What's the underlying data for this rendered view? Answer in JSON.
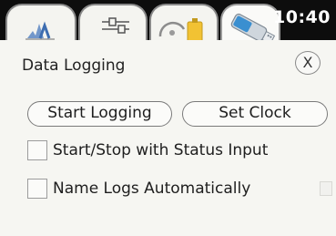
{
  "status": {
    "time": "10:40"
  },
  "tabs": [
    {
      "icon": "signal-chart-icon",
      "active": false
    },
    {
      "icon": "settings-sliders-icon",
      "active": false
    },
    {
      "icon": "gauge-battery-icon",
      "active": false
    },
    {
      "icon": "usb-drive-icon",
      "active": true
    }
  ],
  "panel": {
    "title": "Data Logging",
    "close_label": "X"
  },
  "buttons": {
    "start_logging": "Start Logging",
    "set_clock": "Set Clock"
  },
  "options": [
    {
      "label": "Start/Stop with Status Input",
      "checked": false
    },
    {
      "label": "Name Logs Automatically",
      "checked": false
    }
  ],
  "colors": {
    "tabbar_bg": "#0d0d0d",
    "panel_bg": "#f6f6f2",
    "usb_accent": "#3a8fd0"
  }
}
